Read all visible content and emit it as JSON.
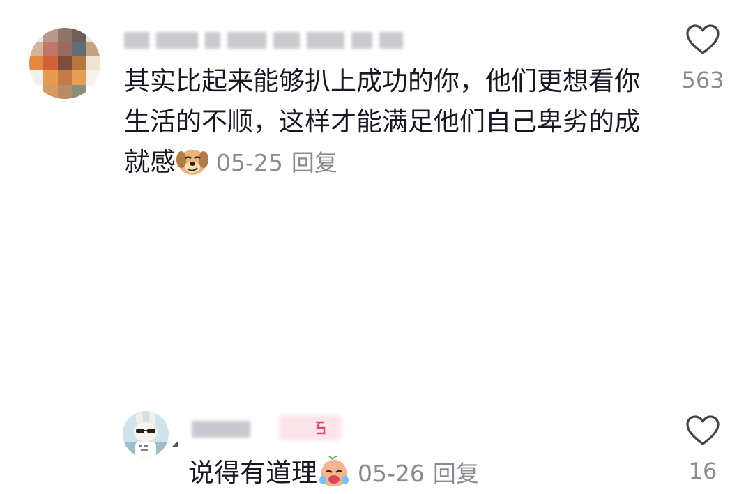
{
  "comments": [
    {
      "text": "其实比起来能够扒上成功的你，他们更想看你生活的不顺，这样才能满足他们自己卑劣的成就感",
      "date": "05-25",
      "reply_label": "回复",
      "likes": "563",
      "emoji": "smirking-dog-emoji"
    },
    {
      "text": "说得有道理",
      "date": "05-26",
      "reply_label": "回复",
      "likes": "16",
      "emoji": "crying-laughing-bean-emoji"
    }
  ],
  "colors": {
    "text": "#161823",
    "meta": "#8a8b91",
    "heart_outline": "#444444"
  }
}
